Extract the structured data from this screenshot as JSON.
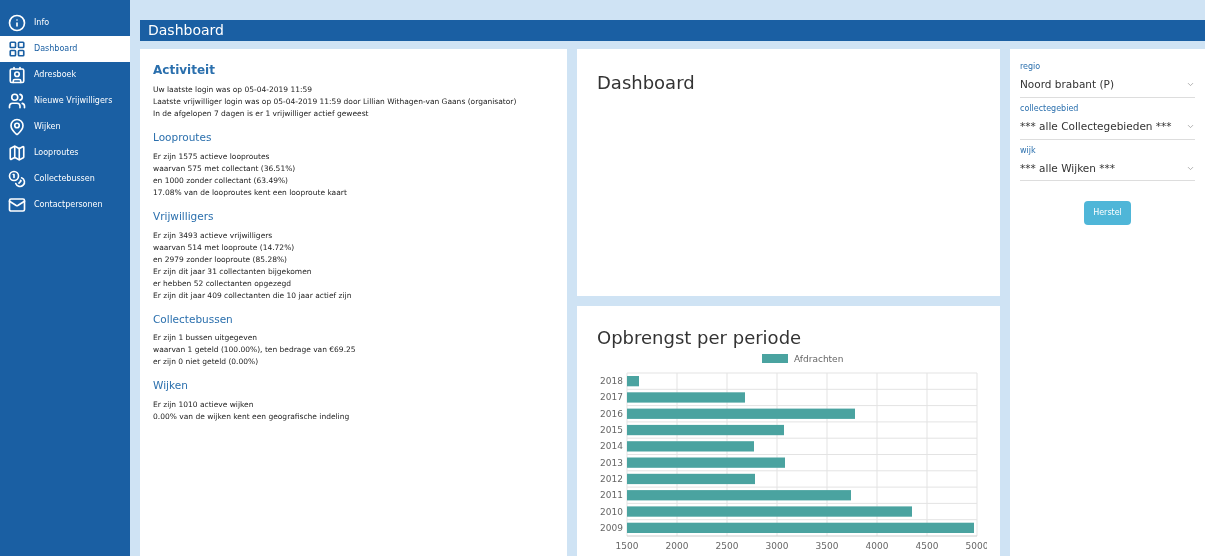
{
  "sidebar": {
    "items": [
      {
        "label": "Info",
        "selected": false
      },
      {
        "label": "Dashboard",
        "selected": true
      },
      {
        "label": "Adresboek",
        "selected": false
      },
      {
        "label": "Nieuwe Vrijwilligers",
        "selected": false
      },
      {
        "label": "Wijken",
        "selected": false
      },
      {
        "label": "Looproutes",
        "selected": false
      },
      {
        "label": "Collectebussen",
        "selected": false
      },
      {
        "label": "Contactpersonen",
        "selected": false
      }
    ]
  },
  "header": {
    "title": "Dashboard"
  },
  "activity": {
    "sections": [
      {
        "title": "Activiteit",
        "lines": [
          "Uw laatste login was op 05-04-2019 11:59",
          "Laatste vrijwilliger login was op 05-04-2019 11:59 door Lillian Withagen-van Gaans (organisator)",
          "In de afgelopen 7 dagen is er 1 vrijwilliger actief geweest"
        ]
      },
      {
        "title": "Looproutes",
        "lines": [
          "Er zijn 1575 actieve looproutes",
          "waarvan 575 met collectant (36.51%)",
          "en 1000 zonder collectant (63.49%)",
          "17.08% van de looproutes kent een looproute kaart"
        ]
      },
      {
        "title": "Vrijwilligers",
        "lines": [
          "Er zijn 3493 actieve vrijwilligers",
          "waarvan 514 met looproute (14.72%)",
          "en 2979 zonder looproute (85.28%)",
          "Er zijn dit jaar 31 collectanten bijgekomen",
          "er hebben 52 collectanten opgezegd",
          "Er zijn dit jaar 409 collectanten die 10 jaar actief zijn"
        ]
      },
      {
        "title": "Collectebussen",
        "lines": [
          "Er zijn 1 bussen uitgegeven",
          "waarvan 1 geteld (100.00%), ten bedrage van €69.25",
          "er zijn 0 niet geteld (0.00%)"
        ]
      },
      {
        "title": "Wijken",
        "lines": [
          "Er zijn 1010 actieve wijken",
          "0.00% van de wijken kent een geografische indeling"
        ]
      }
    ]
  },
  "dashboard_panel": {
    "title": "Dashboard"
  },
  "revenue_panel": {
    "title": "Opbrengst per periode",
    "chart_data": {
      "type": "bar",
      "orientation": "horizontal",
      "categories": [
        "2018",
        "2017",
        "2016",
        "2015",
        "2014",
        "2013",
        "2012",
        "2011",
        "2010",
        "2009"
      ],
      "series": [
        {
          "name": "Afdrachten",
          "color": "#4aa3a0",
          "values": [
            1620,
            2680,
            3780,
            3070,
            2770,
            3080,
            2780,
            3740,
            4350,
            4970
          ]
        }
      ],
      "xlim": [
        1500,
        5000
      ],
      "grid": true,
      "xticks": [
        1500,
        2000,
        2500,
        3000,
        3500,
        4000,
        4500,
        5000
      ]
    }
  },
  "filters": {
    "fields": [
      {
        "label": "regio",
        "value": "Noord brabant (P)"
      },
      {
        "label": "collectegebied",
        "value": "*** alle Collectegebieden ***"
      },
      {
        "label": "wijk",
        "value": "*** alle Wijken ***"
      }
    ],
    "button": "Herstel"
  }
}
